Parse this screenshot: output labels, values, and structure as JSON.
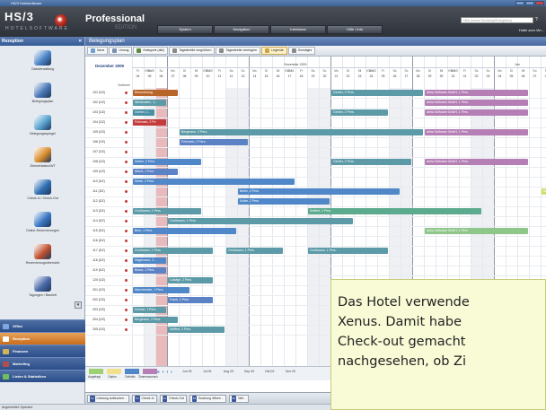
{
  "window": {
    "title": "HS/3 Hotelsoftware"
  },
  "banner": {
    "logo": "HS/3",
    "logo_sub": "HOTELSOFTWARE",
    "edition": "Professional",
    "edition_sub": "EDITION",
    "menu": [
      "System",
      "Navigation",
      "Interfaces",
      "Hilfe / Info"
    ],
    "help_placeholder": "Hilfe (Immer Suchbegriff eingeben)",
    "hotel_name": "Hotel zum Vin..."
  },
  "sidebar": {
    "header": "Rezeption",
    "items": [
      {
        "label": "Gastverwaltung",
        "icon": "guest-card-icon",
        "color": "#4c86c9"
      },
      {
        "label": "Belegungsplan",
        "icon": "calendar-icon",
        "color": "#4b78b8"
      },
      {
        "label": "Belegungsspiegel",
        "icon": "table-grid-icon",
        "color": "#5aa3d1"
      },
      {
        "label": "Zimmerstatus/WT",
        "icon": "phone-icon",
        "color": "#d98c2b"
      },
      {
        "label": "Check-In / Check-Out",
        "icon": "person-icon",
        "color": "#2f6fb3"
      },
      {
        "label": "Online-Reservierungen",
        "icon": "globe-icon",
        "color": "#3b79c4"
      },
      {
        "label": "Reservierungsübersicht",
        "icon": "people-icon",
        "color": "#c0512f"
      },
      {
        "label": "Tagungen / Bankett",
        "icon": "meeting-icon",
        "color": "#4a69a8"
      }
    ],
    "sections": [
      {
        "label": "Office",
        "color": "#7fa7de"
      },
      {
        "label": "Rezeption",
        "color": "#ffffff",
        "active": true
      },
      {
        "label": "Finanzen",
        "color": "#d1b35a"
      },
      {
        "label": "Marketing",
        "color": "#b44c4c"
      },
      {
        "label": "Listen & Statistiken",
        "color": "#6fbf5a"
      }
    ]
  },
  "main": {
    "title": "Belegungsplan",
    "toolbar": [
      {
        "label": "Neue",
        "icon": "new-icon",
        "color": "#6a9fd8"
      },
      {
        "label": "Umzug",
        "icon": "move-icon",
        "color": "#7b8fb0"
      },
      {
        "label": "Kategorie (alle)",
        "icon": "filter-icon",
        "color": "#5d8a3a"
      },
      {
        "label": "Tagesbreite vergrößern",
        "icon": "zoom-in-icon",
        "color": "#8a8a8a"
      },
      {
        "label": "Tagesbreite verringern",
        "icon": "zoom-out-icon",
        "color": "#8a8a8a"
      },
      {
        "label": "Legende",
        "icon": "legend-icon",
        "color": "#c9a44b",
        "active": true
      },
      {
        "label": "Sonstiges",
        "icon": "misc-icon",
        "color": "#8a8a8a"
      }
    ],
    "month_label": "Dezember 2009",
    "sort_label": "Sortieren",
    "months": [
      {
        "label": "Dezember 2009"
      },
      {
        "label": "Jan"
      }
    ],
    "weeks": [
      "KW 49",
      "KW 50",
      "KW 51",
      "KW 52",
      "KW 53"
    ],
    "days": [
      {
        "dow": "Fr",
        "n": "04"
      },
      {
        "dow": "Sa",
        "n": "05"
      },
      {
        "dow": "So",
        "n": "06"
      },
      {
        "dow": "Mo",
        "n": "07"
      },
      {
        "dow": "Di",
        "n": "08"
      },
      {
        "dow": "Mi",
        "n": "09"
      },
      {
        "dow": "Do",
        "n": "10"
      },
      {
        "dow": "Fr",
        "n": "11"
      },
      {
        "dow": "Sa",
        "n": "12"
      },
      {
        "dow": "So",
        "n": "13"
      },
      {
        "dow": "Mo",
        "n": "14"
      },
      {
        "dow": "Di",
        "n": "15"
      },
      {
        "dow": "Mi",
        "n": "16"
      },
      {
        "dow": "Do",
        "n": "17"
      },
      {
        "dow": "Fr",
        "n": "18"
      },
      {
        "dow": "Sa",
        "n": "19"
      },
      {
        "dow": "So",
        "n": "20"
      },
      {
        "dow": "Mo",
        "n": "21"
      },
      {
        "dow": "Di",
        "n": "22"
      },
      {
        "dow": "Mi",
        "n": "23"
      },
      {
        "dow": "Do",
        "n": "24"
      },
      {
        "dow": "Fr",
        "n": "25"
      },
      {
        "dow": "Sa",
        "n": "26"
      },
      {
        "dow": "So",
        "n": "27"
      },
      {
        "dow": "Mo",
        "n": "28"
      },
      {
        "dow": "Di",
        "n": "29"
      },
      {
        "dow": "Mi",
        "n": "30"
      },
      {
        "dow": "Do",
        "n": "31"
      },
      {
        "dow": "Fr",
        "n": "01"
      },
      {
        "dow": "Sa",
        "n": "02"
      },
      {
        "dow": "So",
        "n": "03"
      },
      {
        "dow": "Mo",
        "n": "04"
      },
      {
        "dow": "Di",
        "n": "05"
      },
      {
        "dow": "Mi",
        "n": "06"
      },
      {
        "dow": "Do",
        "n": "07"
      },
      {
        "dow": "Fr",
        "n": "08"
      },
      {
        "dow": "Sa",
        "n": "09"
      },
      {
        "dow": "So",
        "n": "10"
      }
    ],
    "rooms": [
      "101 (DZ)",
      "102 (DZ)",
      "103 (DZ)",
      "104 (DZ)",
      "105 (DZ)",
      "106 (DZ)",
      "107 (DZ)",
      "108 (DZ)",
      "109 (DZ)",
      "110 (DZ)",
      "111 (DZ)",
      "112 (DZ)",
      "113 (DZ)",
      "114 (DZ)",
      "115 (DZ)",
      "116 (DZ)",
      "117 (DZ)",
      "118 (DZ)",
      "119 (DZ)",
      "120 (DZ)",
      "201 (EZ)",
      "202 (DZ)",
      "203 (DZ)",
      "204 (DZ)",
      "205 (DZ)"
    ],
    "bookings": [
      {
        "room": 0,
        "start": 0,
        "len": 4,
        "label": "Renovierung",
        "color": "#b8652a"
      },
      {
        "room": 0,
        "start": 17,
        "len": 8,
        "label": "Gerber, 2 Pers.",
        "color": "#5c9aa7"
      },
      {
        "room": 0,
        "start": 25,
        "len": 9,
        "label": "detra Software GmbH, 1 Pers.",
        "color": "#b57fb6"
      },
      {
        "room": 1,
        "start": 0,
        "len": 3,
        "label": "Weidenkeb., 1...",
        "color": "#5c9aa7"
      },
      {
        "room": 1,
        "start": 25,
        "len": 9,
        "label": "detra Software GmbH, 1 Pers.",
        "color": "#b57fb6"
      },
      {
        "room": 2,
        "start": 0,
        "len": 2,
        "label": "Gerber, 2...",
        "color": "#4a8fa4"
      },
      {
        "room": 2,
        "start": 17,
        "len": 5,
        "label": "Gerber, 2 Pers.",
        "color": "#5c9aa7"
      },
      {
        "room": 2,
        "start": 25,
        "len": 9,
        "label": "detra Software GmbH, 1 Pers.",
        "color": "#b57fb6"
      },
      {
        "room": 3,
        "start": 0,
        "len": 3,
        "label": "Frühwein, 2 Pe",
        "color": "#c43b3b"
      },
      {
        "room": 4,
        "start": 4,
        "len": 21,
        "label": "Bergmann, 2 Pers.",
        "color": "#5c9aa7"
      },
      {
        "room": 4,
        "start": 25,
        "len": 9,
        "label": "detra Software GmbH, 1 Pers.",
        "color": "#b57fb6"
      },
      {
        "room": 5,
        "start": 4,
        "len": 6,
        "label": "Frühwein, 2 Pers.",
        "color": "#5a82c4"
      },
      {
        "room": 7,
        "start": 0,
        "len": 6,
        "label": "Seiber, 2 Pers.",
        "color": "#4f87c8"
      },
      {
        "room": 7,
        "start": 17,
        "len": 7,
        "label": "Gerber, 2 Pers.",
        "color": "#5c9aa7"
      },
      {
        "room": 7,
        "start": 25,
        "len": 9,
        "label": "detra Software GmbH, 1 Pers.",
        "color": "#b57fb6"
      },
      {
        "room": 8,
        "start": 0,
        "len": 4,
        "label": "Albert, 1 Pers.",
        "color": "#5a82c4"
      },
      {
        "room": 9,
        "start": 0,
        "len": 14,
        "label": "Seide, 2 Pers.",
        "color": "#4f87c8"
      },
      {
        "room": 10,
        "start": 9,
        "len": 14,
        "label": "Beller, 2 Pers.",
        "color": "#4f87c8"
      },
      {
        "room": 10,
        "start": 35,
        "len": 3,
        "label": "Schäfer, 1...",
        "color": "#cfe06a"
      },
      {
        "room": 11,
        "start": 9,
        "len": 8,
        "label": "Kolbe, 2 Pers.",
        "color": "#4f87c8"
      },
      {
        "room": 12,
        "start": 0,
        "len": 6,
        "label": "Großmann, 1 Pers.",
        "color": "#5c9aa7"
      },
      {
        "room": 12,
        "start": 15,
        "len": 15,
        "label": "Seiffert, 1 Pers.",
        "color": "#5cab8f"
      },
      {
        "room": 13,
        "start": 3,
        "len": 16,
        "label": "Großmann, 1 Pers.",
        "color": "#5c9aa7"
      },
      {
        "room": 14,
        "start": 0,
        "len": 9,
        "label": "Beer, 1 Pers.",
        "color": "#4f87c8"
      },
      {
        "room": 14,
        "start": 25,
        "len": 9,
        "label": "detra Software GmbH, 1 Pers.",
        "color": "#8fc68a"
      },
      {
        "room": 16,
        "start": 0,
        "len": 7,
        "label": "Großmann, 1 Pers.",
        "color": "#5c9aa7"
      },
      {
        "room": 16,
        "start": 8,
        "len": 5,
        "label": "Großmann, 1 Pers.",
        "color": "#5c9aa7"
      },
      {
        "room": 16,
        "start": 15,
        "len": 7,
        "label": "Großmann, 1 Pers.",
        "color": "#5c9aa7"
      },
      {
        "room": 17,
        "start": 0,
        "len": 3,
        "label": "Hagemann, 2...",
        "color": "#4f87c8"
      },
      {
        "room": 18,
        "start": 0,
        "len": 3,
        "label": "Braun, 1 Pers.",
        "color": "#5a82c4"
      },
      {
        "room": 19,
        "start": 3,
        "len": 4,
        "label": "Lutwige, 2 Pers.",
        "color": "#5c9aa7"
      },
      {
        "room": 20,
        "start": 0,
        "len": 5,
        "label": "Marcheneke, 1 Pers.",
        "color": "#4f87c8"
      },
      {
        "room": 21,
        "start": 3,
        "len": 4,
        "label": "Frank, 2 Pers.",
        "color": "#5a82c4"
      },
      {
        "room": 22,
        "start": 0,
        "len": 3,
        "label": "Kremer, 1 Pers.",
        "color": "#5c9aa7"
      },
      {
        "room": 23,
        "start": 0,
        "len": 4,
        "label": "Bergmann, 2 Pers.",
        "color": "#5c9aa7"
      },
      {
        "room": 24,
        "start": 3,
        "len": 5,
        "label": "Seiffert, 1 Pers.",
        "color": "#5c9aa7"
      }
    ],
    "legend": [
      {
        "label": "Angefragt",
        "color": "#9bd16e"
      },
      {
        "label": "Option",
        "color": "#f2e08a"
      },
      {
        "label": "Definitiv",
        "color": "#4f87c8"
      },
      {
        "label": "Zimmerwunsch",
        "color": "#b57fb6"
      }
    ],
    "nav": {
      "buttons": [
        "«",
        "‹",
        "‹",
        "‹"
      ],
      "months": [
        "Jun 09",
        "Jul 09",
        "Aug 09",
        "Sep 09",
        "Okt 09",
        "Nov 09"
      ]
    }
  },
  "quickbar": [
    {
      "key": "F2",
      "label": "Leistung aufbuchen..."
    },
    {
      "key": "F3",
      "label": "Check-In"
    },
    {
      "key": "F4",
      "label": "Check-Out"
    },
    {
      "key": "F5",
      "label": "Buchung öffnen..."
    },
    {
      "key": "F6",
      "label": "Wei..."
    }
  ],
  "status": "Angemeldet: Operator",
  "overlay": {
    "lines": [
      "Das Hotel verwende",
      "Xenus. Damit habe",
      "Check-out gemacht",
      "nachgesehen, ob Zi"
    ]
  }
}
